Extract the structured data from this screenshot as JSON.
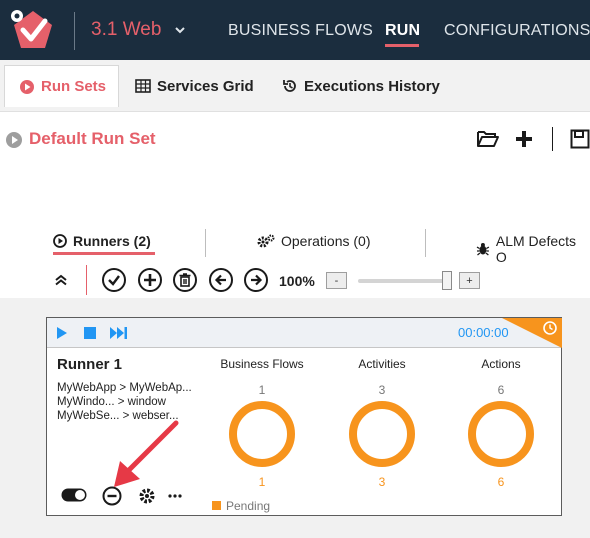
{
  "app": {
    "solution_name": "3.1 Web",
    "nav": [
      {
        "label": "BUSINESS FLOWS",
        "active": false
      },
      {
        "label": "RUN",
        "active": true
      },
      {
        "label": "CONFIGURATIONS",
        "active": false
      }
    ],
    "accent_color": "#e5606a",
    "topbar_color": "#1b2d3e"
  },
  "subtabs": [
    {
      "label": "Run Sets",
      "icon": "play-circle-icon",
      "active": true
    },
    {
      "label": "Services Grid",
      "icon": "grid-table-icon",
      "active": false
    },
    {
      "label": "Executions History",
      "icon": "history-icon",
      "active": false
    }
  ],
  "runset": {
    "title": "Default Run Set",
    "toolbar_icons": [
      "open-folder-icon",
      "add-icon",
      "save-icon"
    ]
  },
  "inner_tabs": [
    {
      "label": "Runners (2)",
      "icon": "play-circle-icon",
      "active": true
    },
    {
      "label": "Operations (0)",
      "icon": "gears-icon",
      "active": false
    },
    {
      "label": "ALM Defects O",
      "icon": "bug-icon",
      "active": false
    }
  ],
  "runners_toolbar": {
    "buttons": [
      "collapse-icon",
      "check-icon",
      "add-runner-icon",
      "delete-icon",
      "previous-icon",
      "next-icon"
    ],
    "zoom_label": "100%",
    "zoom_minus": "-",
    "zoom_plus": "+",
    "zoom_level_fraction": 0.92
  },
  "runner": {
    "name": "Runner 1",
    "elapsed": "00:00:00",
    "targets": [
      "MyWebApp > MyWebAp...",
      "MyWindo... > window",
      "MyWebSe... > webser..."
    ],
    "columns": [
      {
        "title": "Business Flows",
        "total": "1",
        "done": "1"
      },
      {
        "title": "Activities",
        "total": "3",
        "done": "3"
      },
      {
        "title": "Actions",
        "total": "6",
        "done": "6"
      }
    ],
    "status_label": "Pending",
    "status_color": "#f7941d",
    "running_color": "#2196f3"
  }
}
